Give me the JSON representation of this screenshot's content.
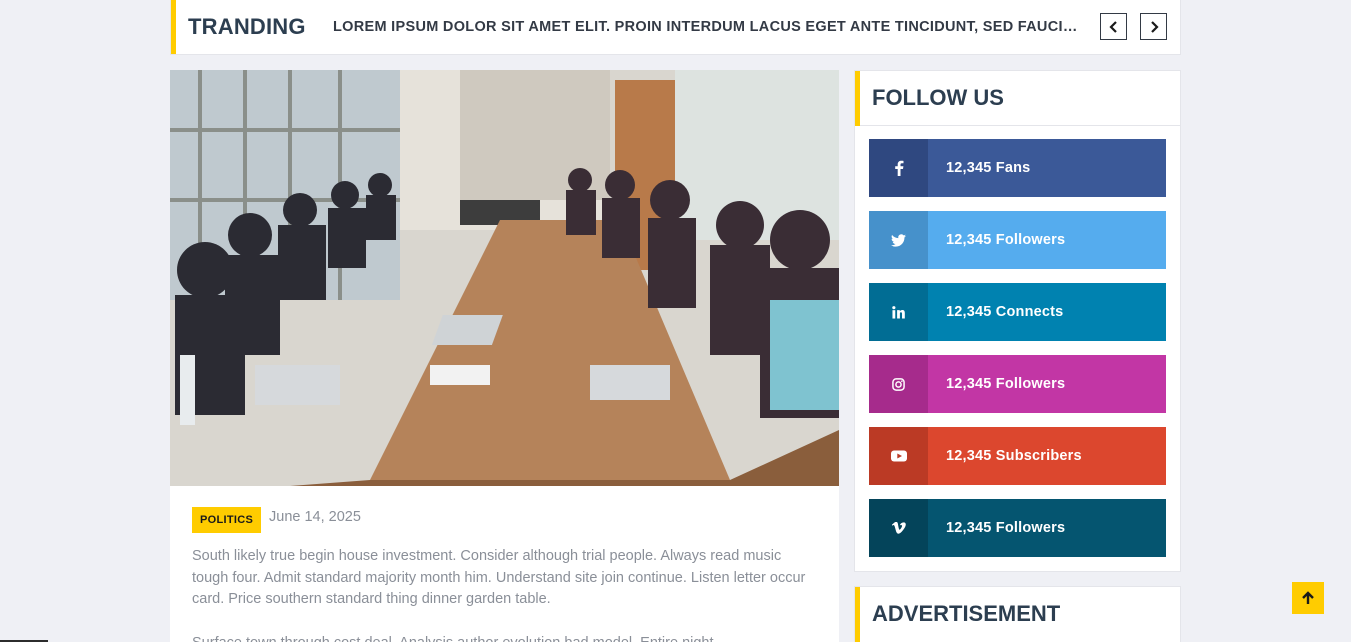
{
  "trending": {
    "title": "TRANDING",
    "headline": "LOREM IPSUM DOLOR SIT AMET ELIT. PROIN INTERDUM LACUS EGET ANTE TINCIDUNT, SED FAUCIBUS NISL SODALES",
    "prev_icon": "chevron-left-icon",
    "next_icon": "chevron-right-icon"
  },
  "post": {
    "category": "POLITICS",
    "date": "June 14, 2025",
    "excerpt": "South likely true begin house investment. Consider although trial people. Always read music tough four. Admit standard majority month him. Understand site join continue. Listen letter occur card. Price southern standard thing dinner garden table.",
    "excerpt2": "Surface town through cost deal. Analysis author evolution bad model. Entire night"
  },
  "follow": {
    "title": "FOLLOW US",
    "items": [
      {
        "icon": "facebook-icon",
        "glyph": "f",
        "label": "12,345 Fans",
        "color": "#3b5998",
        "dark": "#2f4880"
      },
      {
        "icon": "twitter-icon",
        "glyph": "🐦",
        "label": "12,345 Followers",
        "color": "#55acee",
        "dark": "#4691cb"
      },
      {
        "icon": "linkedin-icon",
        "glyph": "in",
        "label": "12,345 Connects",
        "color": "#0082b0",
        "dark": "#016d94"
      },
      {
        "icon": "instagram-icon",
        "glyph": "◎",
        "label": "12,345 Followers",
        "color": "#c236a5",
        "dark": "#a62b8c"
      },
      {
        "icon": "youtube-icon",
        "glyph": "▶",
        "label": "12,345 Subscribers",
        "color": "#dc472e",
        "dark": "#bb3a25"
      },
      {
        "icon": "vimeo-icon",
        "glyph": "v",
        "label": "12,345 Followers",
        "color": "#055570",
        "dark": "#04445a"
      }
    ]
  },
  "advertisement": {
    "title": "ADVERTISEMENT"
  },
  "back_to_top": {
    "icon": "arrow-up-icon"
  },
  "colors": {
    "accent": "#ffcc00",
    "heading": "#2c3e50",
    "muted_text": "#8a8f98"
  }
}
